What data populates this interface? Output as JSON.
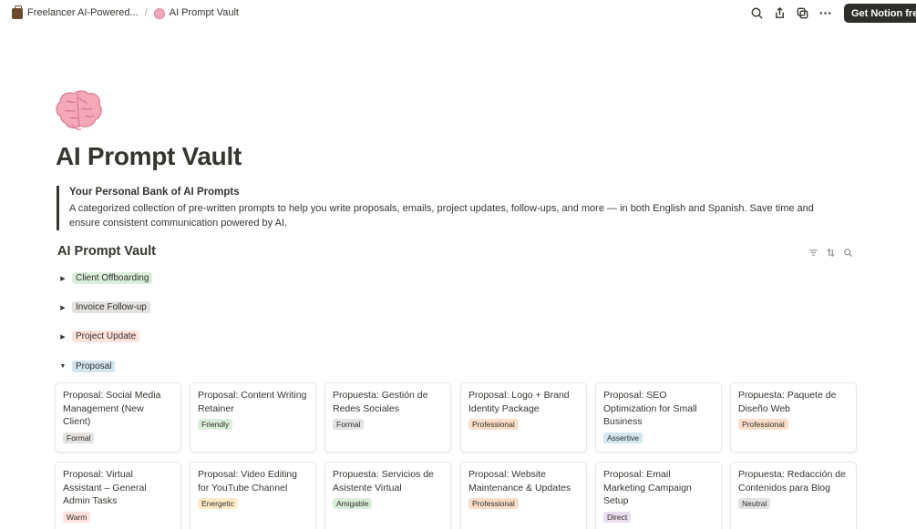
{
  "breadcrumb": {
    "parent_label": "Freelancer AI-Powered...",
    "parent_icon": "briefcase-icon",
    "current_label": "AI Prompt Vault",
    "current_icon": "brain-icon",
    "separator": "/"
  },
  "topbar": {
    "actions": [
      "search-icon",
      "share-icon",
      "duplicate-icon",
      "more-icon"
    ],
    "cta_label": "Get Notion free"
  },
  "page": {
    "icon": "brain-icon",
    "title": "AI Prompt Vault"
  },
  "callout": {
    "heading": "Your Personal Bank of AI Prompts",
    "body": "A categorized collection of pre-written prompts to help you write proposals, emails, project updates, follow-ups, and more — in both English and Spanish. Save time and ensure consistent communication powered by AI."
  },
  "database": {
    "title": "AI Prompt Vault",
    "tools": [
      "filter-icon",
      "sort-icon",
      "search-icon"
    ],
    "groups": [
      {
        "label": "Client Offboarding",
        "expanded": false,
        "color": "#dbeddb"
      },
      {
        "label": "Invoice Follow-up",
        "expanded": false,
        "color": "#e3e2e0"
      },
      {
        "label": "Project Update",
        "expanded": false,
        "color": "#ffe2dd"
      },
      {
        "label": "Proposal",
        "expanded": true,
        "color": "#d3e5ef"
      }
    ],
    "cards": [
      {
        "title": "Proposal: Social Media Management (New Client)",
        "tag": "Formal",
        "tag_color": "#e3e2e0"
      },
      {
        "title": "Proposal: Content Writing Retainer",
        "tag": "Friendly",
        "tag_color": "#dbeddb"
      },
      {
        "title": "Propuesta: Gestión de Redes Sociales",
        "tag": "Formal",
        "tag_color": "#e3e2e0"
      },
      {
        "title": "Proposal: Logo + Brand Identity Package",
        "tag": "Professional",
        "tag_color": "#fadec9"
      },
      {
        "title": "Proposal: SEO Optimization for Small Business",
        "tag": "Assertive",
        "tag_color": "#d3e5ef"
      },
      {
        "title": "Propuesta: Paquete de Diseño Web",
        "tag": "Professional",
        "tag_color": "#fadec9"
      },
      {
        "title": "Proposal: Virtual Assistant – General Admin Tasks",
        "tag": "Warm",
        "tag_color": "#ffe2dd"
      },
      {
        "title": "Proposal: Video Editing for YouTube Channel",
        "tag": "Energetic",
        "tag_color": "#fdecc8"
      },
      {
        "title": "Propuesta: Servicios de Asistente Virtual",
        "tag": "Amigable",
        "tag_color": "#dbeddb"
      },
      {
        "title": "Proposal: Website Maintenance & Updates",
        "tag": "Professional",
        "tag_color": "#fadec9"
      },
      {
        "title": "Proposal: Email Marketing Campaign Setup",
        "tag": "Direct",
        "tag_color": "#e8deee"
      },
      {
        "title": "Propuesta: Redacción de Contenidos para Blog",
        "tag": "Neutral",
        "tag_color": "#e3e2e0"
      }
    ]
  }
}
